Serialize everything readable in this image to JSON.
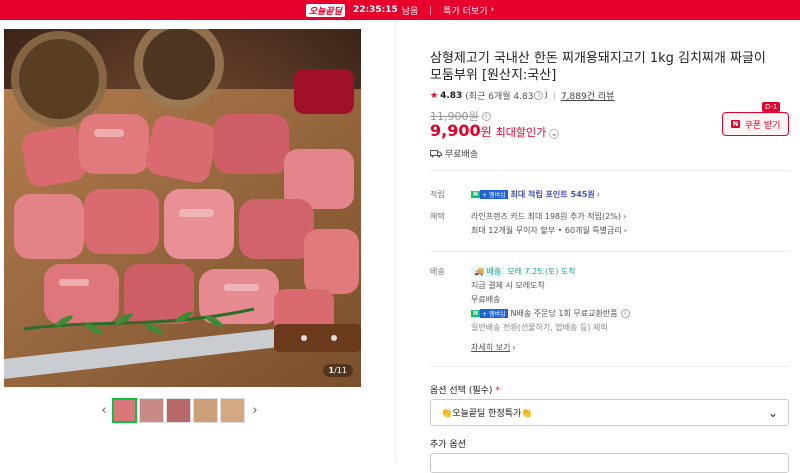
{
  "topbar": {
    "brand": "오늘끝딜",
    "timer": "22:35:15",
    "timer_suffix": "남음",
    "more": "특가 더보기"
  },
  "gallery": {
    "counter_current": "1",
    "counter_total": "/11",
    "thumb_count": 5,
    "prev_icon": "chevron-left-icon",
    "next_icon": "chevron-right-icon"
  },
  "product": {
    "title": "삼형제고기 국내산 한돈 찌개용돼지고기 1kg 김치찌개 짜글이 모둠부위 [원산지:국산]",
    "rating": "4.83",
    "rating_detail": "(최근 6개월 4.83",
    "review_count": "7,889건 리뷰",
    "original_price": "11,900원",
    "price": "9,900",
    "price_unit": "원",
    "best_discount": "최대할인가",
    "coupon_label": "쿠폰 받기",
    "coupon_badge": "D-1",
    "free_shipping": "무료배송"
  },
  "benefits": {
    "points_label": "적립",
    "points_text": "최대 적립 포인트",
    "points_value": "545원",
    "perks_label": "혜택",
    "perk1": "라인프렌즈 카드 최대 198원 추가 적립(2%)",
    "perk2": "최대 12개월 무이자 할부 • 60개월 특별금리"
  },
  "delivery": {
    "label": "배송",
    "badge": "배송",
    "arrival": "모레 7.25.(토) 도착",
    "note": "지금 결제 시 모레도착",
    "fee": "무료배송",
    "npay_text": "N배송 주문당 1회 무료교환반품",
    "excluded": "일반배송 전환(선물하기, 합배송 등) 제외",
    "more": "자세히 보기"
  },
  "options": {
    "select_label": "옵션 선택 (필수)",
    "required_mark": "*",
    "selected": "👏오늘끝딜 한정특가👏",
    "additional_label": "추가 옵션"
  },
  "colors": {
    "accent": "#e8002c",
    "npay_green": "#03c75a",
    "thumb_active": "#00c73c"
  }
}
